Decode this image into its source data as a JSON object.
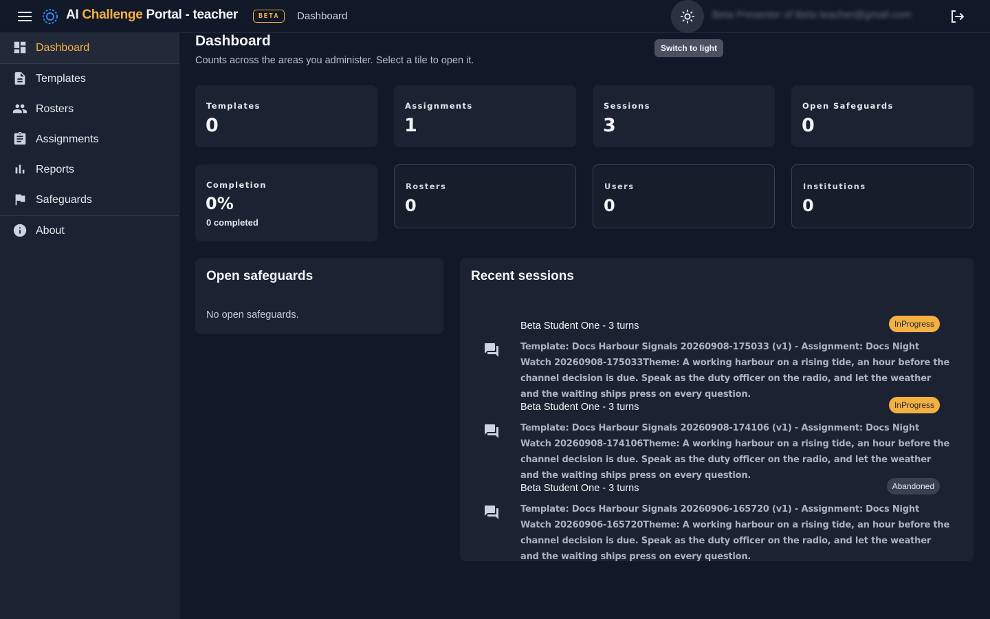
{
  "app": {
    "title_main": "AI ",
    "title_accent": "Challenge",
    "title_rest": " Portal - teacher",
    "beta": "BETA",
    "breadcrumb": "Dashboard",
    "theme_tooltip": "Switch to light",
    "user_email": "Beta Presenter of Beta teacher@gmail.com"
  },
  "sidebar": {
    "items": [
      {
        "label": "Dashboard",
        "icon": "dashboard-icon",
        "active": true
      },
      {
        "label": "Templates",
        "icon": "document-icon"
      },
      {
        "label": "Rosters",
        "icon": "people-icon"
      },
      {
        "label": "Assignments",
        "icon": "clipboard-icon"
      },
      {
        "label": "Reports",
        "icon": "bar-chart-icon"
      },
      {
        "label": "Safeguards",
        "icon": "flag-icon"
      },
      {
        "label": "About",
        "icon": "info-icon"
      }
    ]
  },
  "main": {
    "title": "Dashboard",
    "subtitle": "Counts across the areas you administer. Select a tile to open it.",
    "tiles": [
      {
        "label": "Templates",
        "value": "0"
      },
      {
        "label": "Assignments",
        "value": "1"
      },
      {
        "label": "Sessions",
        "value": "3"
      },
      {
        "label": "Open Safeguards",
        "value": "0"
      },
      {
        "label": "Completion",
        "value": "0%",
        "note": "0 completed"
      },
      {
        "label": "Rosters",
        "value": "0"
      },
      {
        "label": "Users",
        "value": "0"
      },
      {
        "label": "Institutions",
        "value": "0"
      }
    ],
    "safeguards": {
      "title": "Open safeguards",
      "empty": "No open safeguards."
    },
    "recent": {
      "title": "Recent sessions",
      "sessions": [
        {
          "title": "Beta Student One - 3 turns",
          "status": "InProgress",
          "body": "Template: Docs Harbour Signals 20260908-175033 (v1) - Assignment: Docs Night Watch 20260908-175033Theme: A working harbour on a rising tide, an hour before the channel decision is due. Speak as the duty officer on the radio, and let the weather and the waiting ships press on every question."
        },
        {
          "title": "Beta Student One - 3 turns",
          "status": "InProgress",
          "body": "Template: Docs Harbour Signals 20260908-174106 (v1) - Assignment: Docs Night Watch 20260908-174106Theme: A working harbour on a rising tide, an hour before the channel decision is due. Speak as the duty officer on the radio, and let the weather and the waiting ships press on every question."
        },
        {
          "title": "Beta Student One - 3 turns",
          "status": "Abandoned",
          "body": "Template: Docs Harbour Signals 20260906-165720 (v1) - Assignment: Docs Night Watch 20260906-165720Theme: A working harbour on a rising tide, an hour before the channel decision is due. Speak as the duty officer on the radio, and let the weather and the waiting ships press on every question."
        }
      ]
    }
  },
  "colors": {
    "accent": "#f5b042",
    "background": "#111827",
    "surface": "#1b2232",
    "status_inprogress": "#f5b042",
    "status_abandoned": "#374151"
  }
}
